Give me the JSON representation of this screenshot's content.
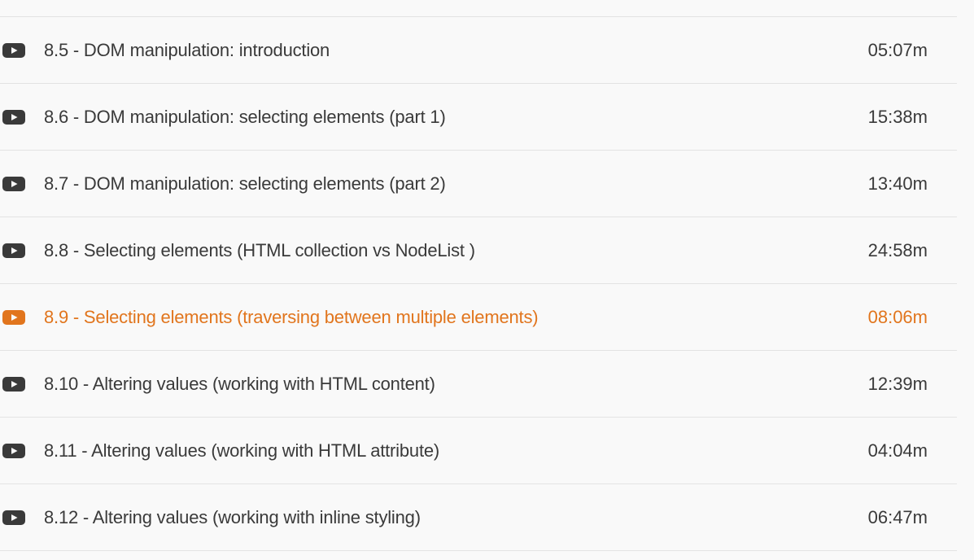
{
  "colors": {
    "text": "#3a3a3a",
    "active": "#e1751d",
    "divider": "#e3e3e3",
    "background": "#f9f9f9"
  },
  "lessons": [
    {
      "icon": "play-video-icon",
      "title": "8.5 - DOM manipulation: introduction",
      "duration": "05:07m",
      "active": false
    },
    {
      "icon": "play-video-icon",
      "title": "8.6 - DOM manipulation: selecting elements (part 1)",
      "duration": "15:38m",
      "active": false
    },
    {
      "icon": "play-video-icon",
      "title": "8.7 - DOM manipulation: selecting elements (part 2)",
      "duration": "13:40m",
      "active": false
    },
    {
      "icon": "play-video-icon",
      "title": "8.8 - Selecting elements (HTML collection vs NodeList )",
      "duration": "24:58m",
      "active": false
    },
    {
      "icon": "play-video-icon",
      "title": "8.9 - Selecting elements (traversing between multiple elements)",
      "duration": "08:06m",
      "active": true
    },
    {
      "icon": "play-video-icon",
      "title": "8.10 - Altering values (working with HTML content)",
      "duration": "12:39m",
      "active": false
    },
    {
      "icon": "play-video-icon",
      "title": "8.11 - Altering values (working with HTML attribute)",
      "duration": "04:04m",
      "active": false
    },
    {
      "icon": "play-video-icon",
      "title": "8.12 - Altering values (working with inline styling)",
      "duration": "06:47m",
      "active": false
    }
  ]
}
